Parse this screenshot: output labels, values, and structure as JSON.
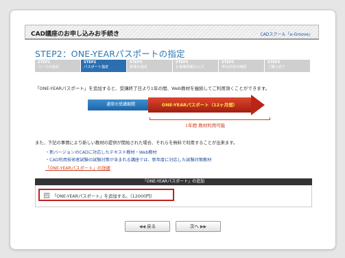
{
  "header": {
    "title": "CAD講座のお申し込みお手続き",
    "brand": "CADスクール「e-Groove」"
  },
  "page_title": "STEP2：ONE-YEARパスポートの指定",
  "steps": [
    {
      "num": "STEP1",
      "label": "コースの指定"
    },
    {
      "num": "STEP2",
      "label": "パスポート指定"
    },
    {
      "num": "STEP3",
      "label": "数量の指定"
    },
    {
      "num": "STEP4",
      "label": "お客様情報の入力"
    },
    {
      "num": "STEP5",
      "label": "申込内容の確認"
    },
    {
      "num": "STEP6",
      "label": "ご購入完了"
    }
  ],
  "intro": "「ONE-YEARパスポート」を追加すると、受講終了日より1年の間、Web教材を継続してご利用頂くことができます。",
  "diagram": {
    "normal_period": "通常の受講期間",
    "passport": "ONE-YEARパスポート（12ヶ月間）",
    "period_note": "1年間 教材利用可能"
  },
  "note": "また、下記の事情により新しい教材の提供が開始された場合、それらを無料で利用することが出来ます。",
  "bullets": [
    "・新バージョンのCADに対応したテキスト教材・Web教材",
    "・CAD利用技術者試験の試験対策が含まれる講座では、新年度に対応した試験対策教材"
  ],
  "detail_link": "「ONE-YEARパスポート」の詳細",
  "option_header": "「ONE-YEARパスポート」の追加",
  "option_label": "「ONE-YEARパスポート」を追加する。〔12000円〕",
  "nav": {
    "back": "戻る",
    "next": "次へ"
  },
  "colors": {
    "accent_blue": "#2b6fb0",
    "passport_red": "#c0201a"
  }
}
